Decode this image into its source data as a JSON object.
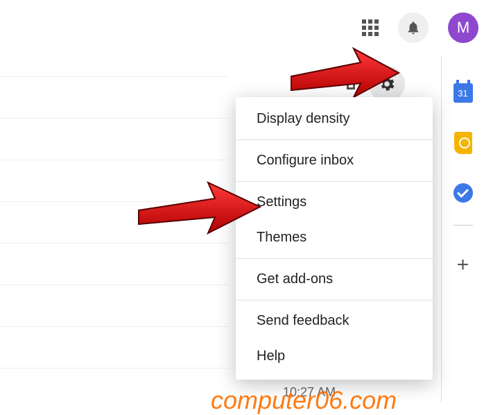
{
  "header": {
    "avatar_initial": "M"
  },
  "menu": {
    "items": [
      "Display density",
      "Configure inbox",
      "Settings",
      "Themes",
      "Get add-ons",
      "Send feedback",
      "Help"
    ]
  },
  "sidepanel": {
    "calendar_day": "31"
  },
  "timestamp": "10:27 AM",
  "watermark": "computer06.com"
}
